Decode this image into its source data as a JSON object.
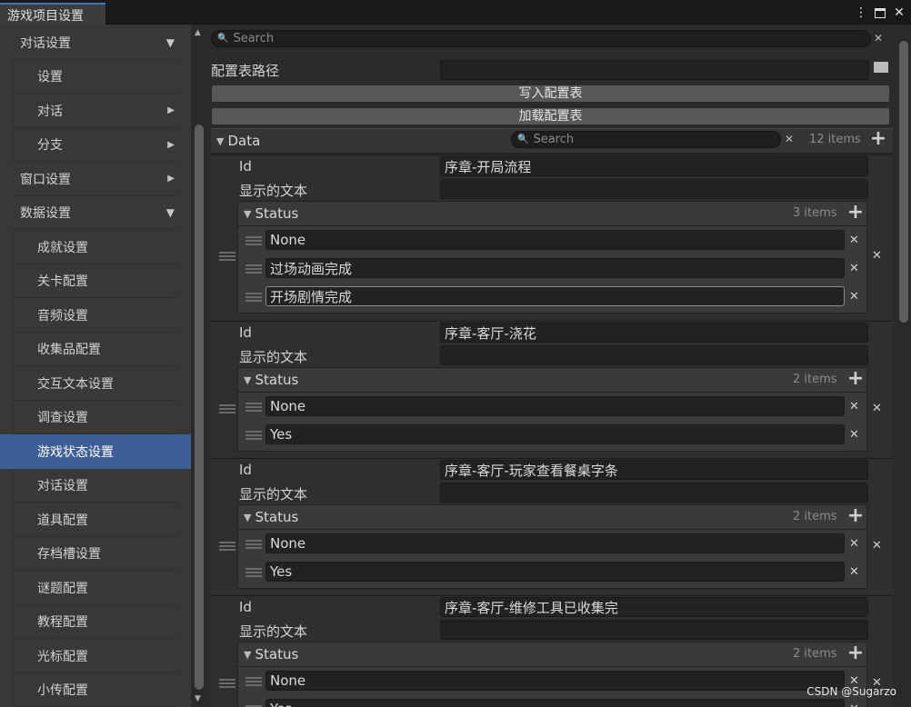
{
  "window": {
    "tab_title": "游戏项目设置",
    "menu_icon": "kebab-menu-icon",
    "maximize_icon": "maximize-icon",
    "close_icon": "close-icon"
  },
  "sidebar": {
    "items": [
      {
        "label": "对话设置",
        "level": "top",
        "arrow": "down"
      },
      {
        "label": "设置",
        "level": "sub",
        "arrow": ""
      },
      {
        "label": "对话",
        "level": "sub",
        "arrow": "right"
      },
      {
        "label": "分支",
        "level": "sub",
        "arrow": "right"
      },
      {
        "label": "窗口设置",
        "level": "top",
        "arrow": "right"
      },
      {
        "label": "数据设置",
        "level": "top",
        "arrow": "down"
      },
      {
        "label": "成就设置",
        "level": "sub",
        "arrow": ""
      },
      {
        "label": "关卡配置",
        "level": "sub",
        "arrow": ""
      },
      {
        "label": "音频设置",
        "level": "sub",
        "arrow": ""
      },
      {
        "label": "收集品配置",
        "level": "sub",
        "arrow": ""
      },
      {
        "label": "交互文本设置",
        "level": "sub",
        "arrow": ""
      },
      {
        "label": "调查设置",
        "level": "sub",
        "arrow": ""
      },
      {
        "label": "游戏状态设置",
        "level": "sub",
        "arrow": "",
        "selected": true
      },
      {
        "label": "对话设置",
        "level": "sub",
        "arrow": ""
      },
      {
        "label": "道具配置",
        "level": "sub",
        "arrow": ""
      },
      {
        "label": "存档槽设置",
        "level": "sub",
        "arrow": ""
      },
      {
        "label": "谜题配置",
        "level": "sub",
        "arrow": ""
      },
      {
        "label": "教程配置",
        "level": "sub",
        "arrow": ""
      },
      {
        "label": "光标配置",
        "level": "sub",
        "arrow": ""
      },
      {
        "label": "小传配置",
        "level": "sub",
        "arrow": ""
      }
    ]
  },
  "main": {
    "search_placeholder": "Search",
    "config_path_label": "配置表路径",
    "config_path_value": "",
    "write_button": "写入配置表",
    "load_button": "加载配置表",
    "data_label": "Data",
    "data_search_placeholder": "Search",
    "data_count": "12 items",
    "id_label": "Id",
    "display_text_label": "显示的文本",
    "status_label": "Status",
    "entries": [
      {
        "id": "序章-开局流程",
        "display_text": "",
        "count": "3 items",
        "statuses": [
          "None",
          "过场动画完成",
          "开场剧情完成"
        ]
      },
      {
        "id": "序章-客厅-浇花",
        "display_text": "",
        "count": "2 items",
        "statuses": [
          "None",
          "Yes"
        ]
      },
      {
        "id": "序章-客厅-玩家查看餐桌字条",
        "display_text": "",
        "count": "2 items",
        "statuses": [
          "None",
          "Yes"
        ]
      },
      {
        "id": "序章-客厅-维修工具已收集完",
        "display_text": "",
        "count": "2 items",
        "statuses": [
          "None",
          "Yes"
        ]
      }
    ]
  },
  "watermark": "CSDN @Sugarzo"
}
